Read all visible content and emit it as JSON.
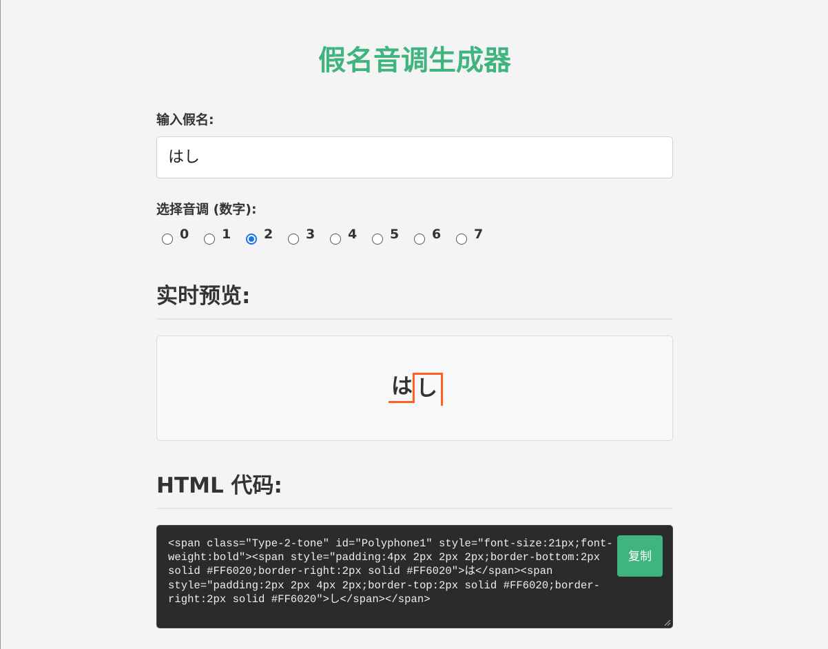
{
  "title": "假名音调生成器",
  "input": {
    "label": "输入假名:",
    "value": "はし"
  },
  "tones": {
    "label": "选择音调 (数字):",
    "options": [
      "0",
      "1",
      "2",
      "3",
      "4",
      "5",
      "6",
      "7"
    ],
    "selected": "2"
  },
  "preview": {
    "heading": "实时预览:",
    "morae": [
      "は",
      "し"
    ],
    "accent_color": "#FF6020"
  },
  "code": {
    "heading": "HTML 代码:",
    "lines": [
      "<span class=\"Type-2-tone\" id=\"Polyphone1\" style=\"font-size:21px;font-",
      "weight:bold\"><span style=\"padding:4px 2px 2px 2px;border-bottom:2px",
      "solid #FF6020;border-right:2px solid #FF6020\">は</span><span",
      "style=\"padding:2px 2px 4px 2px;border-top:2px solid #FF6020;border-",
      "right:2px solid #FF6020\">し</span></span>"
    ],
    "copy_label": "复制"
  },
  "colors": {
    "brand": "#3FB47E",
    "radio_selected": "#1A73E8",
    "code_background": "#2B2B2B"
  }
}
